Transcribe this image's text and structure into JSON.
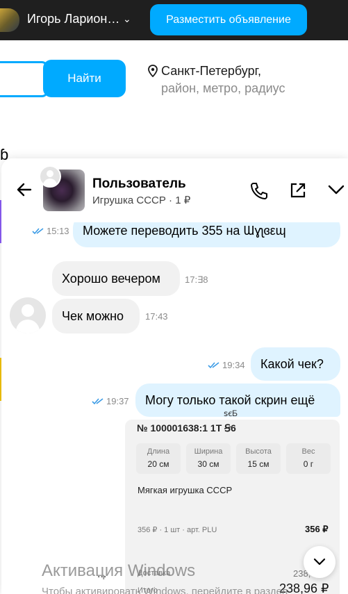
{
  "topbar": {
    "user_name": "Игорь Ларион…",
    "chevron": "⌄",
    "post_button": "Разместить объявление"
  },
  "search": {
    "button": "Найти",
    "city": "Санкт-Петербург,",
    "region": "район, метро, радиус"
  },
  "background_glyph": "ɓ",
  "chat": {
    "user": "Пользователь",
    "item": "Игрушка СССР · 1 ₽",
    "messages": [
      {
        "dir": "out",
        "text": "Можете переводить 355 на  Ɯɣʅɞεɰ",
        "time": "15:13"
      },
      {
        "dir": "in",
        "text": "Хорошо вечером",
        "time": "17:∃8"
      },
      {
        "dir": "in",
        "text": "Чек можно",
        "time": "17:43"
      },
      {
        "dir": "out",
        "text": "Какой чек?",
        "time": "19:34"
      },
      {
        "dir": "out",
        "text": "Могу только такой скрин ещё",
        "time": "19:37"
      }
    ],
    "caption_fragment": "ꜱꞓƂ",
    "receipt": {
      "number": "№ 100001638:1 1T Ꞩ6",
      "dims": [
        {
          "label": "Длина",
          "value": "20 см"
        },
        {
          "label": "Ширина",
          "value": "30 см"
        },
        {
          "label": "Высота",
          "value": "15 см"
        },
        {
          "label": "Вес",
          "value": "0 г"
        }
      ],
      "title": "Мягкая игрушка СССР",
      "line": "356 ₽ · 1 шт · арт. PLU",
      "line_price": "356 ₽",
      "delivery_label": "Доставка",
      "delivery_value": "238,",
      "total_label": "Итого",
      "total_value": "238,96 ₽"
    },
    "typing": "..."
  },
  "watermark": {
    "title": "Активация Windows",
    "subtitle": "Чтобы активировать Windows, перейдите в раздел"
  },
  "colors": {
    "accent": "#00aaff",
    "topbar": "#1f1f1f",
    "out_bubble": "#dff3ff",
    "in_bubble": "#f1f1f1"
  }
}
